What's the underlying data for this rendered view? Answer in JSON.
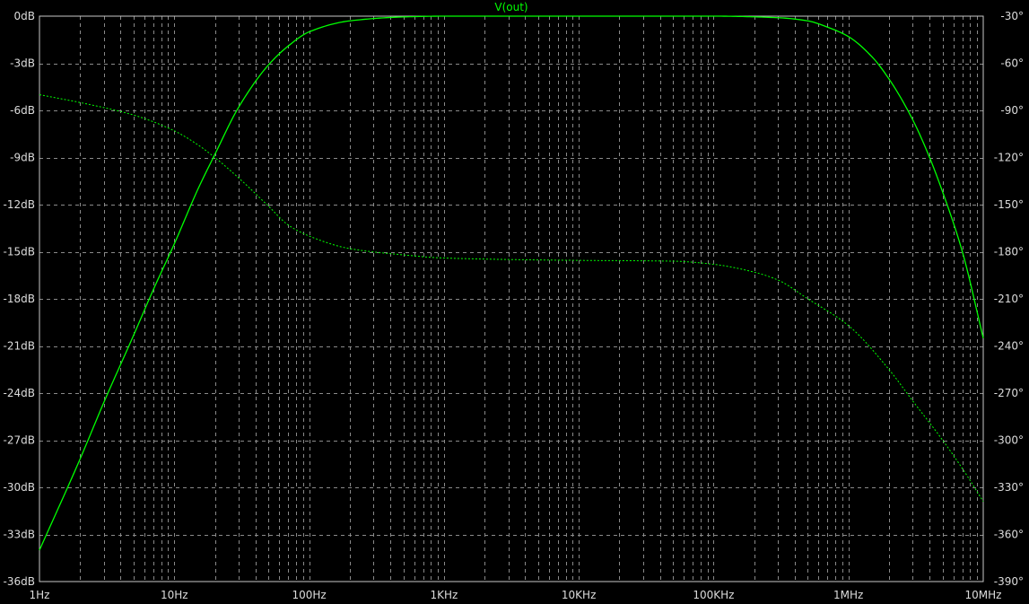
{
  "chart_data": {
    "type": "line",
    "title": "V(out)",
    "x_scale": "log",
    "xlim": [
      "1Hz",
      "10MHz"
    ],
    "x_ticks": [
      "1Hz",
      "10Hz",
      "100Hz",
      "1KHz",
      "10KHz",
      "100KHz",
      "1MHz",
      "10MHz"
    ],
    "x_tick_values": [
      1,
      10,
      100,
      1000,
      10000,
      100000,
      1000000,
      10000000
    ],
    "ylim_left": [
      -36,
      0
    ],
    "y_ticks_left": [
      "0dB",
      "-3dB",
      "-6dB",
      "-9dB",
      "-12dB",
      "-15dB",
      "-18dB",
      "-21dB",
      "-24dB",
      "-27dB",
      "-30dB",
      "-33dB",
      "-36dB"
    ],
    "ylim_right": [
      -390,
      -30
    ],
    "y_ticks_right": [
      "-30°",
      "-60°",
      "-90°",
      "-120°",
      "-150°",
      "-180°",
      "-210°",
      "-240°",
      "-270°",
      "-300°",
      "-330°",
      "-360°",
      "-390°"
    ],
    "grid": true,
    "series": [
      {
        "name": "V(out)",
        "quantity": "magnitude",
        "unit": "dB",
        "axis": "left",
        "style": "solid",
        "color": "#00ff00",
        "points": [
          [
            1,
            -34.0
          ],
          [
            2,
            -28.2
          ],
          [
            3,
            -24.6
          ],
          [
            5,
            -20.3
          ],
          [
            7,
            -17.4
          ],
          [
            10,
            -14.5
          ],
          [
            15,
            -11.0
          ],
          [
            20,
            -8.8
          ],
          [
            30,
            -5.8
          ],
          [
            50,
            -3.1
          ],
          [
            70,
            -1.9
          ],
          [
            100,
            -1.0
          ],
          [
            200,
            -0.3
          ],
          [
            500,
            -0.05
          ],
          [
            1000,
            0
          ],
          [
            100000,
            0
          ],
          [
            300000,
            -0.1
          ],
          [
            500000,
            -0.3
          ],
          [
            700000,
            -0.7
          ],
          [
            1000000,
            -1.3
          ],
          [
            1500000,
            -2.6
          ],
          [
            2000000,
            -4.0
          ],
          [
            3000000,
            -6.6
          ],
          [
            4000000,
            -9.0
          ],
          [
            5000000,
            -11.2
          ],
          [
            7000000,
            -15.0
          ],
          [
            10000000,
            -20.5
          ]
        ]
      },
      {
        "name": "V(out)",
        "quantity": "phase",
        "unit": "deg",
        "axis": "right",
        "style": "dotted",
        "color": "#00ff00",
        "points": [
          [
            1,
            -80
          ],
          [
            2,
            -85
          ],
          [
            5,
            -93
          ],
          [
            10,
            -103
          ],
          [
            15,
            -112
          ],
          [
            20,
            -120
          ],
          [
            30,
            -133
          ],
          [
            50,
            -151
          ],
          [
            70,
            -163
          ],
          [
            100,
            -170
          ],
          [
            200,
            -178
          ],
          [
            500,
            -182
          ],
          [
            1000,
            -184
          ],
          [
            10000,
            -185.5
          ],
          [
            50000,
            -186
          ],
          [
            100000,
            -188
          ],
          [
            200000,
            -193
          ],
          [
            300000,
            -198
          ],
          [
            500000,
            -210
          ],
          [
            1000000,
            -227
          ],
          [
            2000000,
            -255
          ],
          [
            3000000,
            -275
          ],
          [
            5000000,
            -300
          ],
          [
            7000000,
            -318
          ],
          [
            10000000,
            -339
          ]
        ]
      }
    ]
  }
}
